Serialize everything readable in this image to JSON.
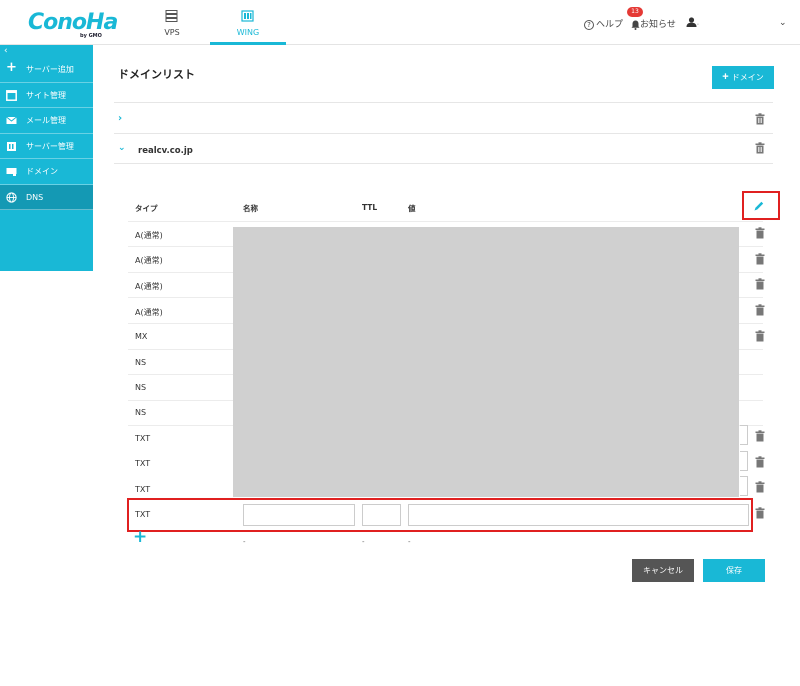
{
  "header": {
    "logo_text": "ConoHa",
    "logo_sub": "by GMO",
    "tabs": [
      {
        "label": "VPS",
        "icon": "server-icon"
      },
      {
        "label": "WING",
        "icon": "building-icon"
      }
    ],
    "help_label": "ヘルプ",
    "notice_label": "お知らせ",
    "notice_count": "13",
    "user_name": ".",
    "accent_color": "#19b8d6"
  },
  "sidebar": {
    "collapse_icon": "‹",
    "items": [
      {
        "label": "サーバー追加",
        "icon": "plus-icon"
      },
      {
        "label": "サイト管理",
        "icon": "window-icon"
      },
      {
        "label": "メール管理",
        "icon": "mail-icon"
      },
      {
        "label": "サーバー管理",
        "icon": "server-manage-icon"
      },
      {
        "label": "ドメイン",
        "icon": "domain-icon"
      },
      {
        "label": "DNS",
        "icon": "globe-icon"
      }
    ]
  },
  "main": {
    "title": "ドメインリスト",
    "add_domain_label": "ドメイン",
    "domain_name": "realcv.co.jp",
    "columns": {
      "type": "タイプ",
      "name": "名称",
      "ttl": "TTL",
      "value": "値"
    },
    "records": [
      "A(通常)",
      "A(通常)",
      "A(通常)",
      "A(通常)",
      "MX",
      "NS",
      "NS",
      "NS",
      "TXT",
      "TXT",
      "TXT"
    ],
    "new_record_type": "TXT",
    "dash": "-",
    "cancel_label": "キャンセル",
    "save_label": "保存"
  }
}
